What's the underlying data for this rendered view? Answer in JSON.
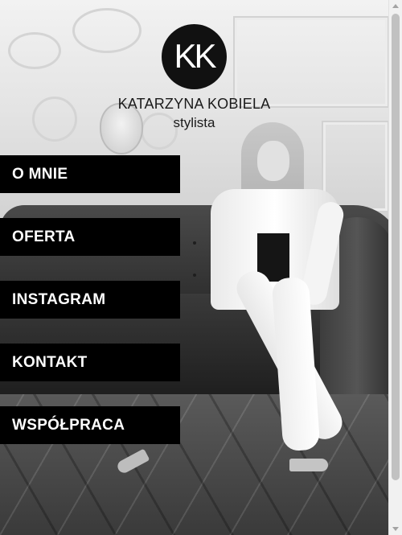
{
  "logo": {
    "monogram": "KK",
    "name": "KATARZYNA KOBIELA",
    "tagline": "stylista"
  },
  "menu": {
    "items": [
      {
        "label": "O MNIE"
      },
      {
        "label": "OFERTA"
      },
      {
        "label": "INSTAGRAM"
      },
      {
        "label": "KONTAKT"
      },
      {
        "label": "WSPÓŁPRACA"
      }
    ]
  },
  "colors": {
    "menu_background": "#000000",
    "menu_text": "#ffffff",
    "logo_circle": "#111111"
  },
  "icons": [
    "scroll-up-arrow-icon",
    "scroll-down-arrow-icon"
  ]
}
